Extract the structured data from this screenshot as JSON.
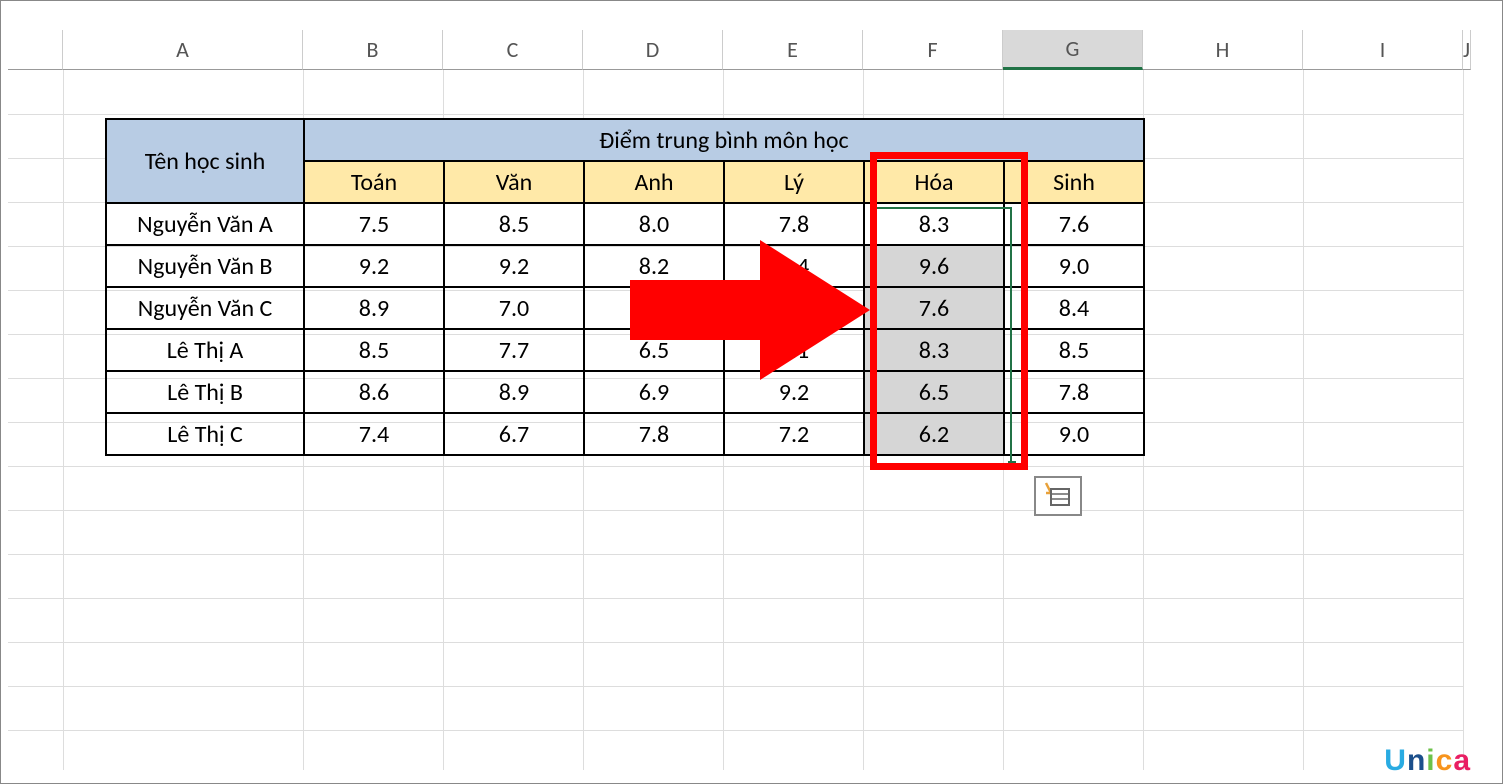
{
  "columns": [
    "A",
    "B",
    "C",
    "D",
    "E",
    "F",
    "G",
    "H",
    "I",
    "J"
  ],
  "active_col": "G",
  "table": {
    "headers": {
      "row_label": "Tên học sinh",
      "merged_title": "Điểm trung bình môn học",
      "subjects": [
        "Toán",
        "Văn",
        "Anh",
        "Lý",
        "Hóa",
        "Sinh"
      ]
    },
    "rows": [
      {
        "name": "Nguyễn Văn A",
        "vals": [
          "7.5",
          "8.5",
          "8.0",
          "7.8",
          "8.3",
          "7.6"
        ]
      },
      {
        "name": "Nguyễn Văn B",
        "vals": [
          "9.2",
          "9.2",
          "8.2",
          "8.4",
          "9.6",
          "9.0"
        ]
      },
      {
        "name": "Nguyễn Văn C",
        "vals": [
          "8.9",
          "7.0",
          "",
          "",
          "7.6",
          "8.4"
        ]
      },
      {
        "name": "Lê Thị A",
        "vals": [
          "8.5",
          "7.7",
          "6.5",
          "8.1",
          "8.3",
          "8.5"
        ]
      },
      {
        "name": "Lê Thị B",
        "vals": [
          "8.6",
          "8.9",
          "6.9",
          "9.2",
          "6.5",
          "7.8"
        ]
      },
      {
        "name": "Lê Thị C",
        "vals": [
          "7.4",
          "6.7",
          "7.8",
          "7.2",
          "6.2",
          "9.0"
        ]
      }
    ]
  },
  "watermark": {
    "u": "U",
    "n": "n",
    "i": "i",
    "c": "c",
    "a": "a"
  }
}
